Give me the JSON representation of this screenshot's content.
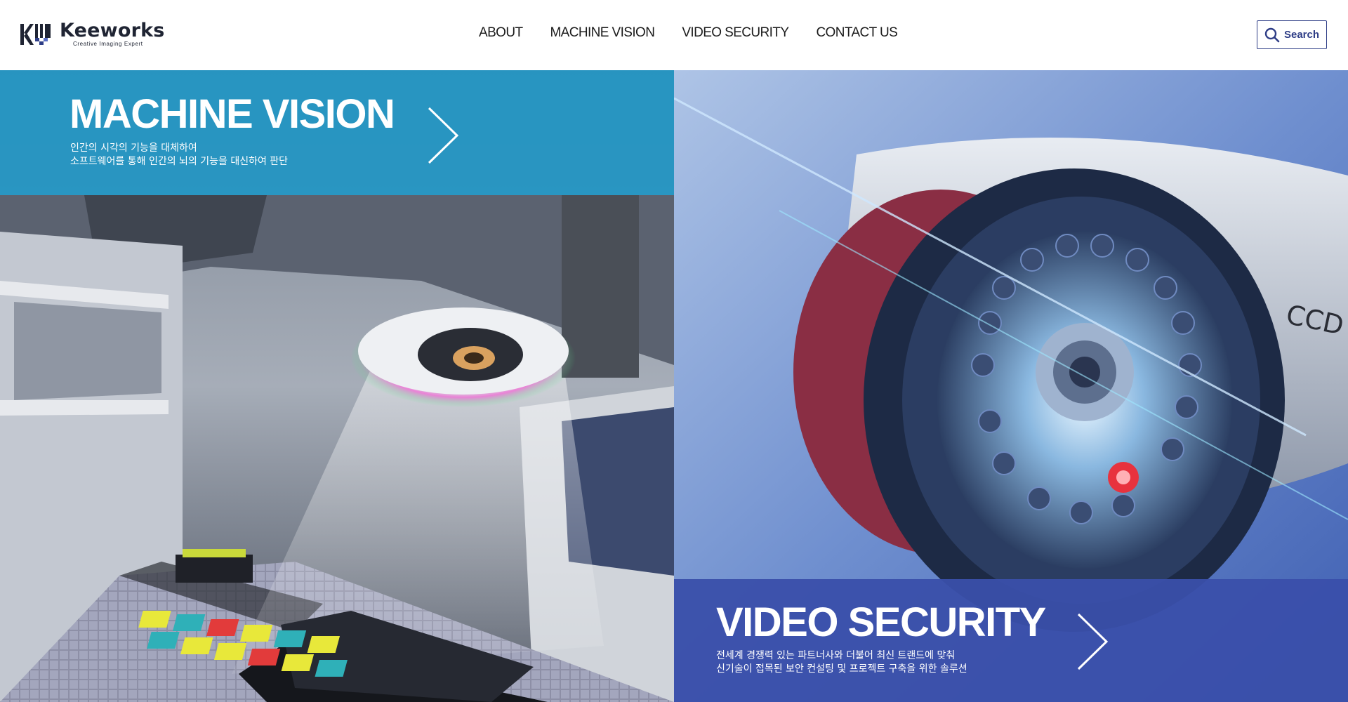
{
  "brand": {
    "name": "Keeworks",
    "tagline": "Creative Imaging Expert",
    "logo_mark": "KW"
  },
  "nav": {
    "items": [
      {
        "label": "ABOUT"
      },
      {
        "label": "MACHINE VISION"
      },
      {
        "label": "VIDEO SECURITY"
      },
      {
        "label": "CONTACT US"
      }
    ]
  },
  "search": {
    "label": "Search",
    "icon": "search-icon"
  },
  "panels": {
    "machine_vision": {
      "title": "MACHINE VISION",
      "line1": "인간의 시각의 기능을 대체하여",
      "line2": "소프트웨어를 통해 인간의 뇌의 기능을 대신하여 판단",
      "band_color": "#2196c4",
      "arrow_icon": "chevron-right-icon"
    },
    "video_security": {
      "title": "VIDEO SECURITY",
      "line1": "전세계 경쟁력 있는 파트너사와 더불어 최신 트랜드에 맞춰",
      "line2": "신기술이 접목된 보안 컨설팅 및 프로젝트 구축을 위한 솔루션",
      "band_color": "#3a4faa",
      "arrow_icon": "chevron-right-icon",
      "camera_text": "CCD cam"
    }
  }
}
